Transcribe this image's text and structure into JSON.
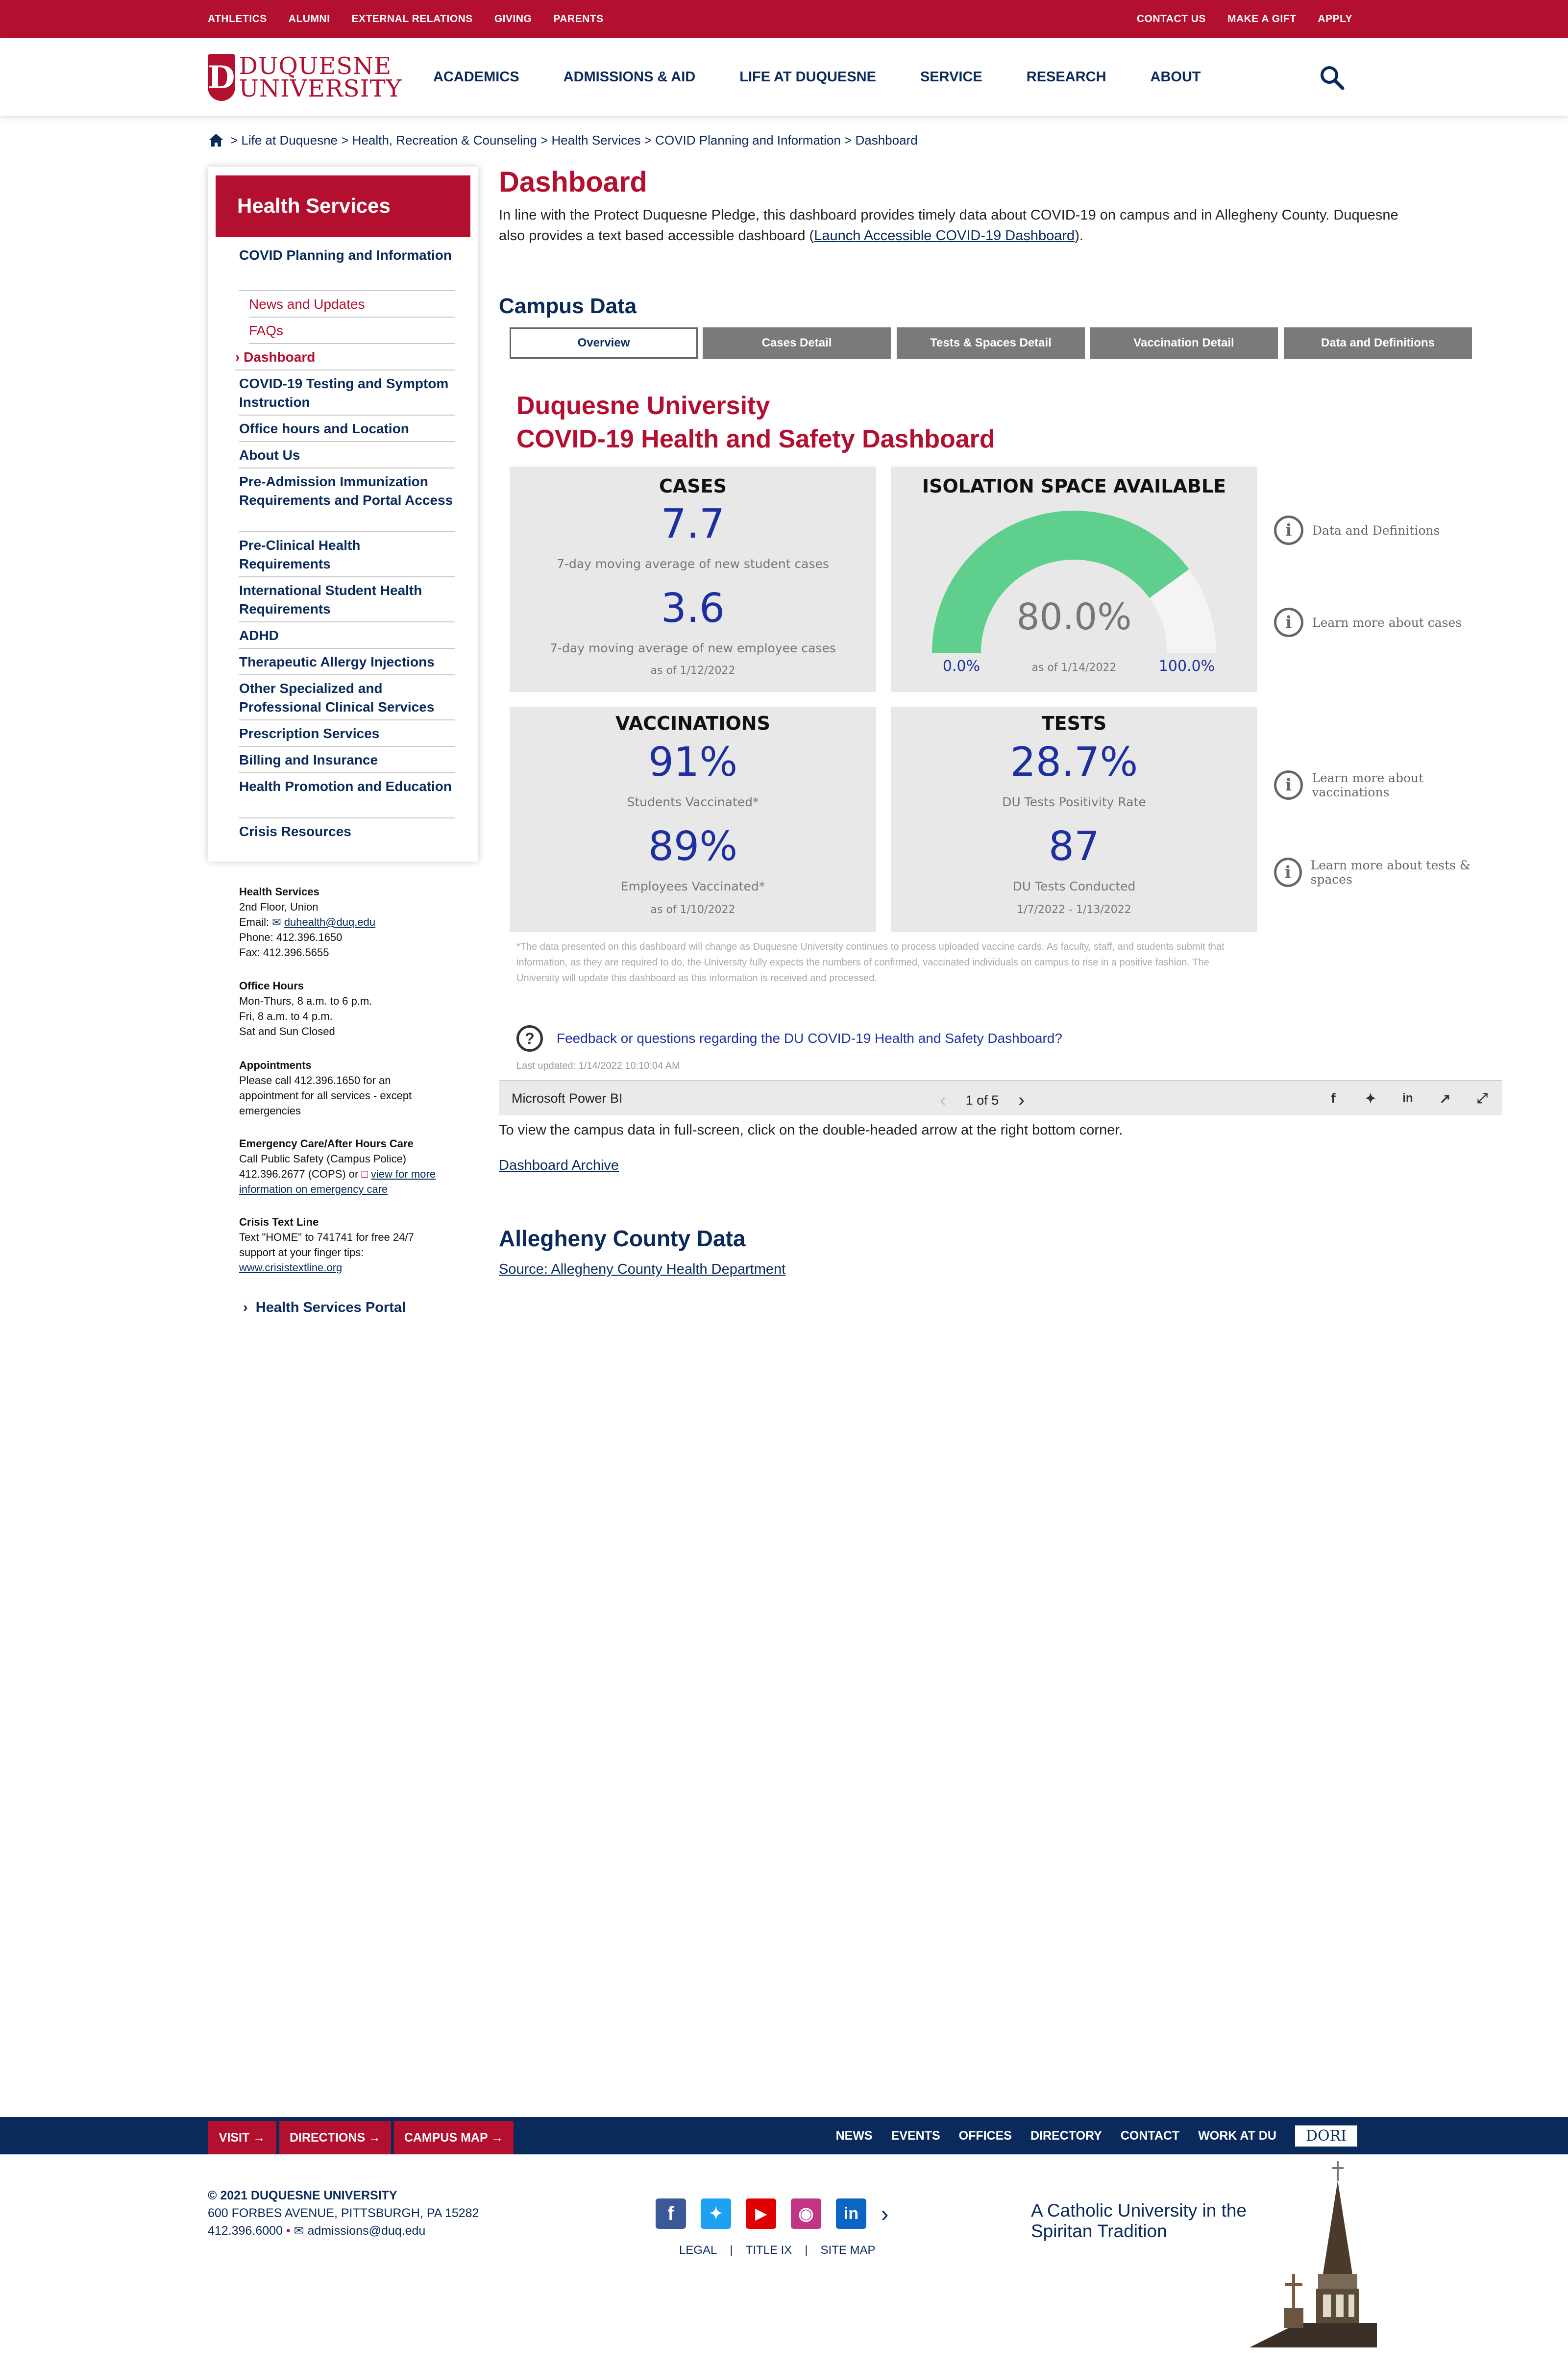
{
  "utility": {
    "left": [
      "ATHLETICS",
      "ALUMNI",
      "EXTERNAL RELATIONS",
      "GIVING",
      "PARENTS"
    ],
    "right": [
      "CONTACT US",
      "MAKE A GIFT",
      "APPLY"
    ]
  },
  "logo": {
    "line1": "DUQUESNE",
    "line2": "UNIVERSITY",
    "mark": "D"
  },
  "nav": [
    "ACADEMICS",
    "ADMISSIONS & AID",
    "LIFE AT DUQUESNE",
    "SERVICE",
    "RESEARCH",
    "ABOUT"
  ],
  "breadcrumb": "> Life at Duquesne > Health, Recreation & Counseling > Health Services > COVID Planning and Information > Dashboard",
  "sidebar": {
    "title": "Health Services",
    "items": [
      "COVID Planning and Information",
      "News and Updates",
      "FAQs",
      "Dashboard",
      "COVID-19 Testing and Symptom Instruction",
      "Office hours and Location",
      "About Us",
      "Pre-Admission Immunization Requirements and Portal Access",
      "Pre-Clinical Health Requirements",
      "International Student Health Requirements",
      "ADHD",
      "Therapeutic Allergy Injections",
      "Other Specialized and Professional Clinical Services",
      "Prescription Services",
      "Billing and Insurance",
      "Health Promotion and Education",
      "Crisis Resources"
    ]
  },
  "contact": {
    "hs_title": "Health Services",
    "hs_addr": "2nd Floor, Union",
    "hs_email_label": "Email:",
    "hs_email": "duhealth@duq.edu",
    "hs_phone": "Phone: 412.396.1650",
    "hs_fax": "Fax: 412.396.5655",
    "hours_title": "Office Hours",
    "hours_1": "Mon-Thurs, 8 a.m. to 6 p.m.",
    "hours_2": "Fri, 8 a.m. to 4 p.m.",
    "hours_3": "Sat and Sun Closed",
    "appt_title": "Appointments",
    "appt_text": "Please call 412.396.1650 for an appointment for all services - except emergencies",
    "emerg_title": "Emergency Care/After Hours Care",
    "emerg_1": "Call Public Safety (Campus Police)",
    "emerg_2": "412.396.2677 (COPS) or",
    "emerg_link": "view for more information on emergency care",
    "crisis_title": "Crisis Text Line",
    "crisis_text": "Text \"HOME\" to 741741 for free 24/7 support at your finger tips:",
    "crisis_link": "www.crisistextline.org",
    "portal": "Health Services Portal"
  },
  "main": {
    "title": "Dashboard",
    "intro_1": "In line with the Protect Duquesne Pledge, this dashboard provides timely data about COVID-19 on campus and in Allegheny County. Duquesne also provides a text based accessible dashboard (",
    "intro_link": "Launch Accessible COVID-19 Dashboard",
    "intro_2": ").",
    "campus_heading": "Campus Data"
  },
  "dashboard": {
    "tabs": [
      "Overview",
      "Cases Detail",
      "Tests & Spaces Detail",
      "Vaccination Detail",
      "Data and Definitions"
    ],
    "title_1": "Duquesne University",
    "title_2": "COVID-19 Health and Safety Dashboard",
    "cases": {
      "title": "CASES",
      "student_value": "7.7",
      "student_label": "7-day moving average of new student cases",
      "employee_value": "3.6",
      "employee_label": "7-day moving average of new employee cases",
      "asof": "as of 1/12/2022"
    },
    "isolation": {
      "title": "ISOLATION SPACE AVAILABLE",
      "value": "80.0%",
      "fraction": 0.8,
      "min": "0.0%",
      "max": "100.0%",
      "asof": "as of 1/14/2022"
    },
    "vaccinations": {
      "title": "VACCINATIONS",
      "students_value": "91%",
      "students_label": "Students Vaccinated*",
      "employees_value": "89%",
      "employees_label": "Employees Vaccinated*",
      "asof": "as of 1/10/2022"
    },
    "tests": {
      "title": "TESTS",
      "positivity_value": "28.7%",
      "positivity_label": "DU Tests Positivity Rate",
      "conducted_value": "87",
      "conducted_label": "DU Tests Conducted",
      "range": "1/7/2022 - 1/13/2022"
    },
    "info_links": [
      "Data and Definitions",
      "Learn more about cases",
      "Learn more about vaccinations",
      "Learn more about tests & spaces"
    ],
    "disclaimer": "*The data presented on this dashboard will change as Duquesne University continues to process uploaded vaccine cards. As faculty, staff, and students submit that information, as they are required to do, the University fully expects the numbers of confirmed, vaccinated individuals on campus to rise in a positive fashion. The University will update this dashboard as this information is received and processed.",
    "feedback": "Feedback or questions regarding the DU COVID-19 Health and Safety Dashboard?",
    "last_updated": "Last updated: 1/14/2022 10:10:04 AM",
    "colors": {
      "gauge_fill": "#5fcf8e",
      "gauge_empty": "#f4f4f4",
      "value": "#1e2fa0"
    }
  },
  "pbibar": {
    "brand": "Microsoft Power BI",
    "page": "1 of 5"
  },
  "after": {
    "fullscreen": "To view the campus data in full-screen, click on the double-headed arrow at the right bottom corner.",
    "archive": "Dashboard Archive",
    "allegheny_heading": "Allegheny County Data",
    "allegheny_source": "Source: Allegheny County Health Department"
  },
  "footer": {
    "buttons": [
      "VISIT →",
      "DIRECTIONS →",
      "CAMPUS MAP →"
    ],
    "links": [
      "NEWS",
      "EVENTS",
      "OFFICES",
      "DIRECTORY",
      "CONTACT",
      "WORK AT DU"
    ],
    "dori": "DORI",
    "copyright": "© 2021 DUQUESNE UNIVERSITY",
    "address": "600 FORBES AVENUE, PITTSBURGH, PA 15282",
    "phone": "412.396.6000",
    "email": "admissions@duq.edu",
    "legal": [
      "LEGAL",
      "TITLE IX",
      "SITE MAP"
    ],
    "tagline_1": "A Catholic University in the",
    "tagline_2": "Spiritan Tradition",
    "brand_red": "#b30f2e",
    "brand_navy": "#0a2a5c"
  }
}
